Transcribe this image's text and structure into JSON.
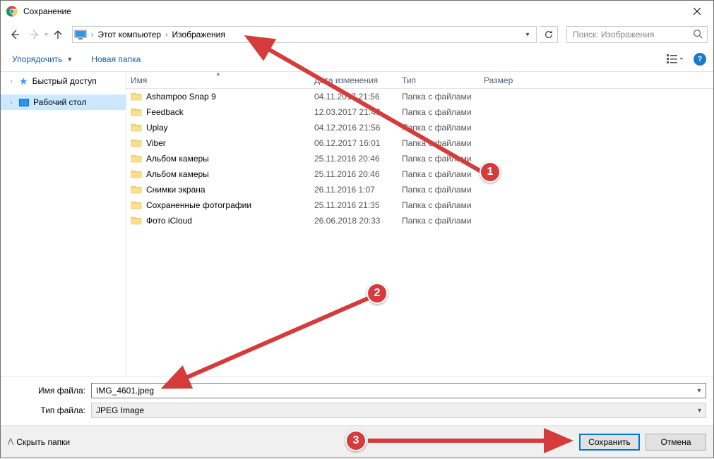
{
  "title": "Сохранение",
  "breadcrumb": {
    "items": [
      "Этот компьютер",
      "Изображения"
    ]
  },
  "search": {
    "placeholder": "Поиск: Изображения"
  },
  "toolbar": {
    "organize": "Упорядочить",
    "new_folder": "Новая папка"
  },
  "sidebar": {
    "quick_access": "Быстрый доступ",
    "desktop": "Рабочий стол"
  },
  "columns": {
    "name": "Имя",
    "date": "Дата изменения",
    "type": "Тип",
    "size": "Размер"
  },
  "rows": [
    {
      "name": "Ashampoo Snap 9",
      "date": "04.11.2017 21:56",
      "type": "Папка с файлами"
    },
    {
      "name": "Feedback",
      "date": "12.03.2017 21:47",
      "type": "Папка с файлами"
    },
    {
      "name": "Uplay",
      "date": "04.12.2016 21:56",
      "type": "Папка с файлами"
    },
    {
      "name": "Viber",
      "date": "06.12.2017 16:01",
      "type": "Папка с файлами"
    },
    {
      "name": "Альбом камеры",
      "date": "25.11.2016 20:46",
      "type": "Папка с файлами"
    },
    {
      "name": "Альбом камеры",
      "date": "25.11.2016 20:46",
      "type": "Папка с файлами"
    },
    {
      "name": "Снимки экрана",
      "date": "26.11.2016 1:07",
      "type": "Папка с файлами"
    },
    {
      "name": "Сохраненные фотографии",
      "date": "25.11.2016 21:35",
      "type": "Папка с файлами"
    },
    {
      "name": "Фото iCloud",
      "date": "26.06.2018 20:33",
      "type": "Папка с файлами"
    }
  ],
  "fields": {
    "filename_label": "Имя файла:",
    "filename_value": "IMG_4601.jpeg",
    "filetype_label": "Тип файла:",
    "filetype_value": "JPEG Image"
  },
  "bottom": {
    "hide_folders": "Скрыть папки",
    "save": "Сохранить",
    "cancel": "Отмена"
  },
  "annotations": {
    "badge1": "1",
    "badge2": "2",
    "badge3": "3"
  }
}
